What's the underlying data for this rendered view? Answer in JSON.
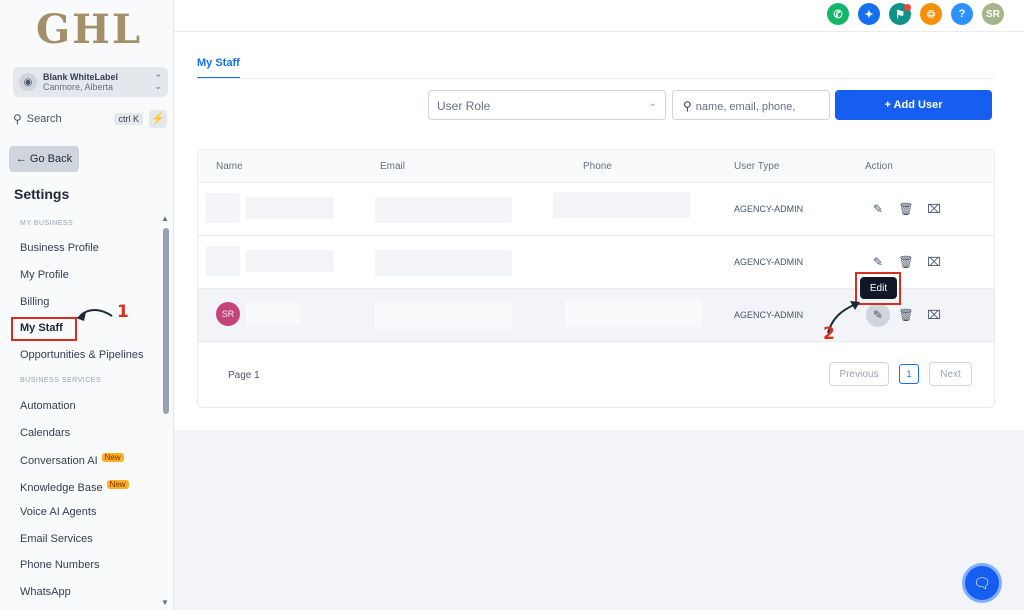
{
  "sidebar": {
    "logo": "GHL",
    "account": {
      "name": "Blank WhiteLabel",
      "location": "Canmore, Alberta"
    },
    "search": {
      "label": "Search",
      "shortcut": "ctrl K"
    },
    "go_back": "← Go Back",
    "title": "Settings",
    "section_my_business": "MY BUSINESS",
    "section_business_services": "BUSINESS SERVICES",
    "items": {
      "business_profile": "Business Profile",
      "my_profile": "My Profile",
      "billing": "Billing",
      "my_staff": "My Staff",
      "opportunities": "Opportunities & Pipelines",
      "automation": "Automation",
      "calendars": "Calendars",
      "conversation_ai": "Conversation AI",
      "knowledge_base": "Knowledge Base",
      "voice_ai": "Voice AI Agents",
      "email_services": "Email Services",
      "phone_numbers": "Phone Numbers",
      "whatsapp": "WhatsApp"
    },
    "new_badge": "New"
  },
  "topbar": {
    "avatar_initials": "SR",
    "help": "?",
    "colors": {
      "phone": "#12b76a",
      "calls": "#1570ef",
      "announce": "#0e9384",
      "bell": "#f79009",
      "help": "#2e90fa",
      "avatar": "#a6b58a"
    }
  },
  "main": {
    "tab": "My Staff",
    "user_role_placeholder": "User Role",
    "search_placeholder": "name, email, phone,",
    "add_user": "+ Add User",
    "table": {
      "headers": {
        "name": "Name",
        "email": "Email",
        "phone": "Phone",
        "user_type": "User Type",
        "action": "Action"
      },
      "rows": [
        {
          "user_type": "AGENCY-ADMIN"
        },
        {
          "user_type": "AGENCY-ADMIN"
        },
        {
          "user_type": "AGENCY-ADMIN",
          "avatar": "SR"
        }
      ]
    },
    "pagination": {
      "label": "Page 1",
      "previous": "Previous",
      "current": "1",
      "next": "Next"
    },
    "tooltip": "Edit"
  },
  "annotations": {
    "step1": "1",
    "step2": "2"
  }
}
